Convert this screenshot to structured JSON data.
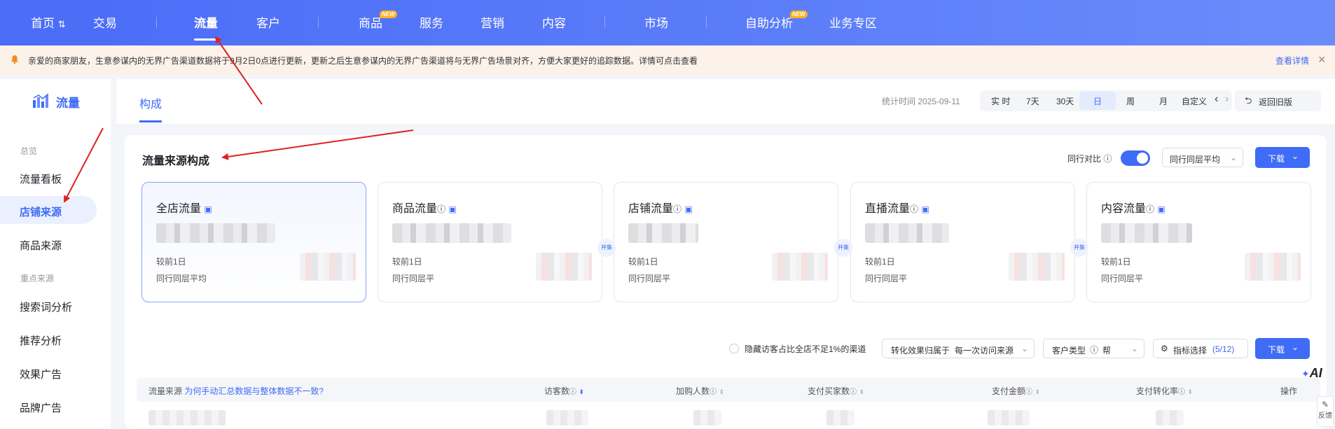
{
  "topnav": {
    "home": "首页",
    "home_icon": "switch-icon",
    "items": [
      "交易",
      "流量",
      "客户",
      "商品",
      "服务",
      "营销",
      "内容",
      "市场",
      "自助分析",
      "业务专区"
    ],
    "new_badge": "NEW"
  },
  "notice": {
    "text": "亲爱的商家朋友，生意参谋内的无界广告渠道数据将于9月2日0点进行更新，更新之后生意参谋内的无界广告渠道将与无界广告场景对齐，方便大家更好的追踪数据。详情可点击查看",
    "link": "查看详情",
    "close": "×"
  },
  "sidebar": {
    "title": "流量",
    "group1": "总览",
    "group2": "重点来源",
    "items": [
      "流量看板",
      "店铺来源",
      "商品来源",
      "搜索词分析",
      "推荐分析",
      "效果广告",
      "品牌广告"
    ]
  },
  "header": {
    "tab": "构成",
    "stat_time": "统计时间 2025-09-11",
    "time_options": [
      "实 时",
      "7天",
      "30天",
      "日",
      "周",
      "月",
      "自定义"
    ],
    "prev": "‹",
    "next": "›",
    "back": "返回旧版"
  },
  "panel": {
    "title": "流量来源构成",
    "peer_compare": "同行对比",
    "peer_select": "同行同层平均",
    "download": "下载",
    "cards": [
      {
        "title": "全店流量",
        "compare": "较前1日",
        "peer": "同行同层平均"
      },
      {
        "title": "商品流量",
        "compare": "较前1日",
        "peer": "同行同层平"
      },
      {
        "title": "店铺流量",
        "compare": "较前1日",
        "peer": "同行同层平"
      },
      {
        "title": "直播流量",
        "compare": "较前1日",
        "peer": "同行同层平"
      },
      {
        "title": "内容流量",
        "compare": "较前1日",
        "peer": "同行同层平"
      }
    ],
    "fold_label": "并集"
  },
  "filters": {
    "hide_label": "隐藏访客占比全店不足1%的渠道",
    "attribution_label": "转化效果归属于",
    "attribution_value": "每一次访问来源",
    "customer_type": "客户类型",
    "customer_value": "帮",
    "metric_select": "指标选择",
    "metric_count": "(5/12)",
    "download": "下载"
  },
  "table": {
    "col_source": "流量来源",
    "col_source_link": "为何手动汇总数据与整体数据不一致?",
    "cols": [
      "访客数",
      "加购人数",
      "支付买家数",
      "支付金额",
      "支付转化率",
      "操作"
    ]
  },
  "floating": {
    "ai": "AI",
    "feedback": "反馈"
  },
  "colors": {
    "accent": "#3f6cf6",
    "nav_gradient_start": "#4a6cf7",
    "arrow": "#e02020"
  }
}
